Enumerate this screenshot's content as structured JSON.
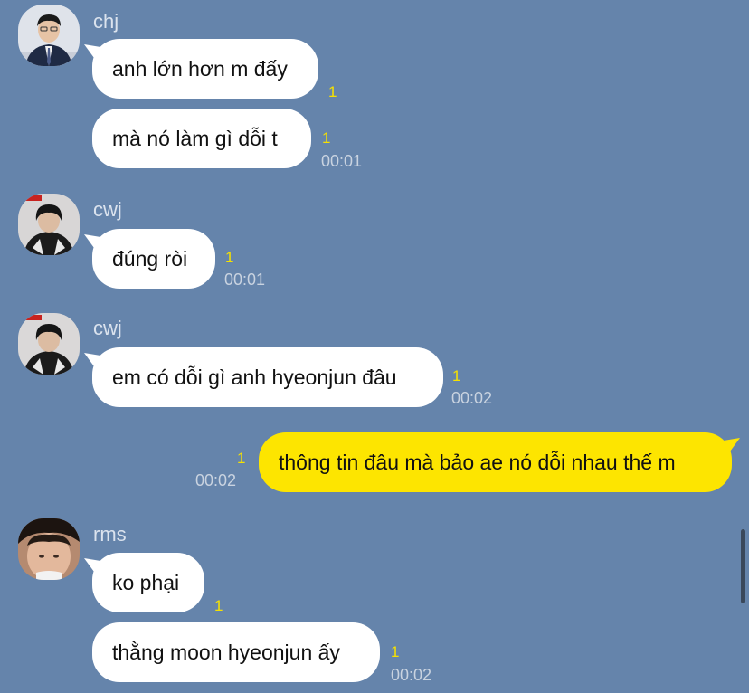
{
  "colors": {
    "background": "#6584ab",
    "incoming_bubble": "#ffffff",
    "outgoing_bubble": "#fde500",
    "unread_count": "#f6e100"
  },
  "groups": [
    {
      "sender": "chj",
      "avatar": "avatar-icon",
      "messages": [
        {
          "text": "anh lớn hơn m đấy",
          "unread": "1",
          "time": ""
        },
        {
          "text": "mà nó làm gì dỗi t",
          "unread": "1",
          "time": "00:01"
        }
      ]
    },
    {
      "sender": "cwj",
      "avatar": "avatar-icon",
      "messages": [
        {
          "text": "đúng ròi",
          "unread": "1",
          "time": "00:01"
        }
      ]
    },
    {
      "sender": "cwj",
      "avatar": "avatar-icon",
      "messages": [
        {
          "text": "em có dỗi gì anh hyeonjun đâu",
          "unread": "1",
          "time": "00:02"
        }
      ]
    },
    {
      "sender": "",
      "outgoing": true,
      "messages": [
        {
          "text": "thông tin đâu mà bảo ae nó dỗi nhau thế m",
          "unread": "1",
          "time": "00:02"
        }
      ]
    },
    {
      "sender": "rms",
      "avatar": "avatar-icon",
      "messages": [
        {
          "text": "ko phại",
          "unread": "1",
          "time": ""
        },
        {
          "text": "thằng moon hyeonjun ấy",
          "unread": "1",
          "time": "00:02"
        }
      ]
    }
  ]
}
